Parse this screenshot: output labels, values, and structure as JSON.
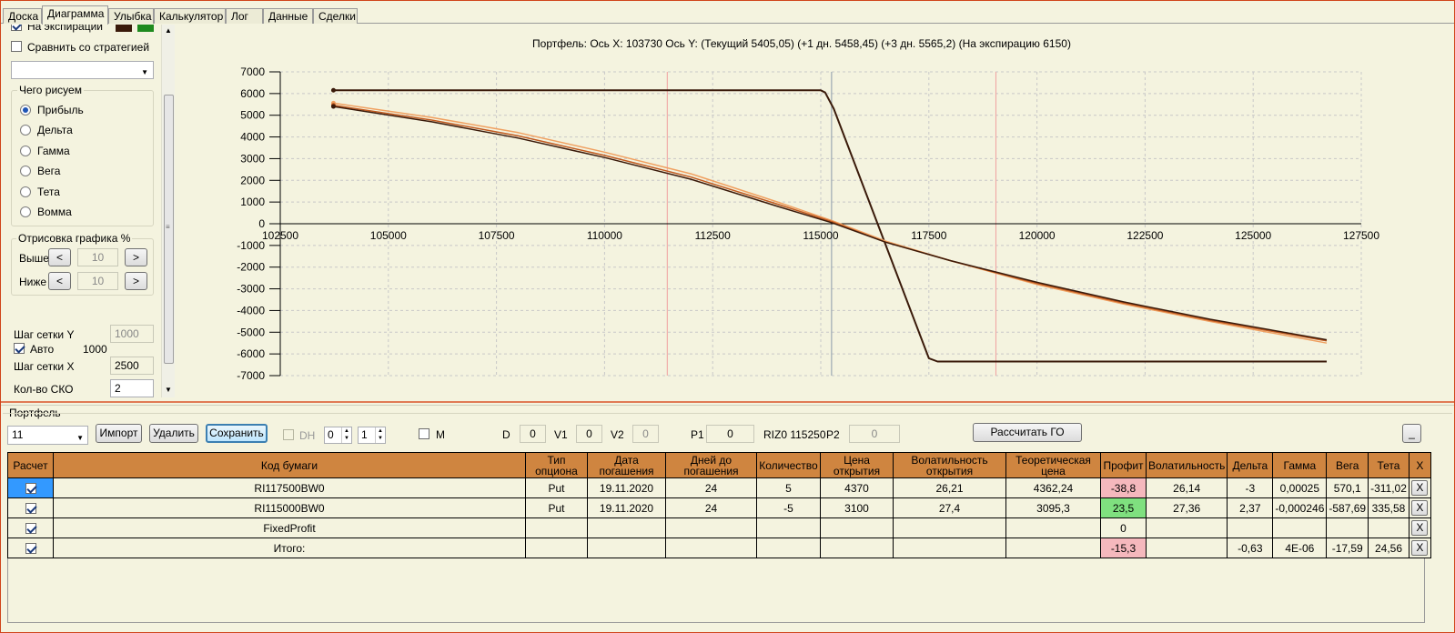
{
  "tabs": [
    "Доска",
    "Диаграмма",
    "Улыбка",
    "Калькулятор",
    "Лог",
    "Данные",
    "Сделки"
  ],
  "active_tab": "Диаграмма",
  "left": {
    "on_expiry_label": "На экспирации",
    "compare_label": "Сравнить со стратегией",
    "strategy_select_value": "",
    "what_draw_title": "Чего рисуем",
    "radios": [
      "Прибыль",
      "Дельта",
      "Гамма",
      "Вега",
      "Тета",
      "Вомма"
    ],
    "selected_radio": "Прибыль",
    "drawing_title": "Отрисовка графика %",
    "above_label": "Выше",
    "above_value": "10",
    "below_label": "Ниже",
    "below_value": "10",
    "prev_label": "<",
    "next_label": ">",
    "grid_y_label": "Шаг сетки Y",
    "grid_y_value": "1000",
    "auto_label": "Авто",
    "auto_value": "1000",
    "grid_x_label": "Шаг сетки X",
    "grid_x_value": "2500",
    "sko_label": "Кол-во СКО",
    "sko_value": "2",
    "colors": {
      "expiry_swatch": "#3a1a0a",
      "compare_swatch": "#1e8a1e"
    }
  },
  "chart_title": "Портфель: Ось X:  103730 Ось Y:   (Текущий 5405,05)  (+1 дн. 5458,45)  (+3 дн. 5565,2)  (На экспирацию 6150)",
  "chart_data": {
    "type": "line",
    "xlim": [
      102500,
      127500
    ],
    "ylim": [
      -7000,
      7000
    ],
    "x_ticks": [
      102500,
      105000,
      107500,
      110000,
      112500,
      115000,
      117500,
      120000,
      122500,
      125000,
      127500
    ],
    "y_ticks": [
      7000,
      6000,
      5000,
      4000,
      3000,
      2000,
      1000,
      0,
      -1000,
      -2000,
      -3000,
      -4000,
      -5000,
      -6000,
      -7000
    ],
    "vertical_markers": [
      {
        "x": 111450,
        "color": "#f0a0a0"
      },
      {
        "x": 115250,
        "color": "#8a9aaa"
      },
      {
        "x": 119050,
        "color": "#f0a0a0"
      }
    ],
    "series": [
      {
        "color": "#3a1a0a",
        "x": [
          103730,
          115000,
          115100,
          115300,
          117500,
          117700,
          126700
        ],
        "y": [
          6150,
          6150,
          6050,
          5300,
          -6200,
          -6350,
          -6350
        ]
      },
      {
        "color": "#f0a060",
        "x": [
          103730,
          106000,
          108000,
          110000,
          112000,
          114000,
          115250,
          116500,
          118000,
          120000,
          122000,
          124000,
          126700
        ],
        "y": [
          5560,
          4900,
          4200,
          3300,
          2300,
          1000,
          150,
          -800,
          -1700,
          -2800,
          -3700,
          -4500,
          -5500
        ]
      },
      {
        "color": "#c05a20",
        "x": [
          103730,
          106000,
          108000,
          110000,
          112000,
          114000,
          115250,
          116500,
          118000,
          120000,
          122000,
          124000,
          126700
        ],
        "y": [
          5458,
          4780,
          4050,
          3150,
          2150,
          900,
          100,
          -850,
          -1700,
          -2750,
          -3650,
          -4450,
          -5400
        ]
      },
      {
        "color": "#3a1a0a",
        "x": [
          103730,
          106000,
          108000,
          110000,
          112000,
          114000,
          115250,
          116500,
          118000,
          120000,
          122000,
          124000,
          126700
        ],
        "y": [
          5405,
          4700,
          3950,
          3050,
          2050,
          800,
          50,
          -850,
          -1700,
          -2700,
          -3600,
          -4400,
          -5350
        ]
      }
    ]
  },
  "portfolio": {
    "title": "Портфель",
    "select_value": "11",
    "import_label": "Импорт",
    "delete_label": "Удалить",
    "save_label": "Сохранить",
    "dh_label": "DH",
    "spin1": "0",
    "spin2": "1",
    "m_label": "M",
    "d_label": "D",
    "d_value": "0",
    "v1_label": "V1",
    "v1_value": "0",
    "v2_label": "V2",
    "v2_value": "0",
    "p1_label": "P1",
    "p1_value": "0",
    "riz_label": "RIZ0 115250",
    "p2_label": "P2",
    "p2_value": "0",
    "calc_go_label": "Рассчитать ГО",
    "minimize_label": "_"
  },
  "table": {
    "headers": [
      "Расчет",
      "Код бумаги",
      "Тип опциона",
      "Дата погашения",
      "Дней до погашения",
      "Количество",
      "Цена открытия",
      "Волатильность открытия",
      "Теоретическая цена",
      "Профит",
      "Волатильность",
      "Дельта",
      "Гамма",
      "Вега",
      "Тета",
      "X"
    ],
    "rows": [
      {
        "code": "RI117500BW0",
        "type": "Put",
        "date": "19.11.2020",
        "days": "24",
        "qty": "5",
        "open_price": "4370",
        "open_vol": "26,21",
        "theo": "4362,24",
        "profit": "-38,8",
        "profit_color": "pink",
        "vol": "26,14",
        "delta": "-3",
        "gamma": "0,00025",
        "vega": "570,1",
        "theta": "-311,02"
      },
      {
        "code": "RI115000BW0",
        "type": "Put",
        "date": "19.11.2020",
        "days": "24",
        "qty": "-5",
        "open_price": "3100",
        "open_vol": "27,4",
        "theo": "3095,3",
        "profit": "23,5",
        "profit_color": "green",
        "vol": "27,36",
        "delta": "2,37",
        "gamma": "-0,000246",
        "vega": "-587,69",
        "theta": "335,58"
      },
      {
        "code": "FixedProfit",
        "type": "",
        "date": "",
        "days": "",
        "qty": "",
        "open_price": "",
        "open_vol": "",
        "theo": "",
        "profit": "0",
        "profit_color": "",
        "vol": "",
        "delta": "",
        "gamma": "",
        "vega": "",
        "theta": ""
      },
      {
        "code": "Итого:",
        "type": "",
        "date": "",
        "days": "",
        "qty": "",
        "open_price": "",
        "open_vol": "",
        "theo": "",
        "profit": "-15,3",
        "profit_color": "pink",
        "vol": "",
        "delta": "-0,63",
        "gamma": "4E-06",
        "vega": "-17,59",
        "theta": "24,56"
      }
    ],
    "x_label": "X"
  }
}
